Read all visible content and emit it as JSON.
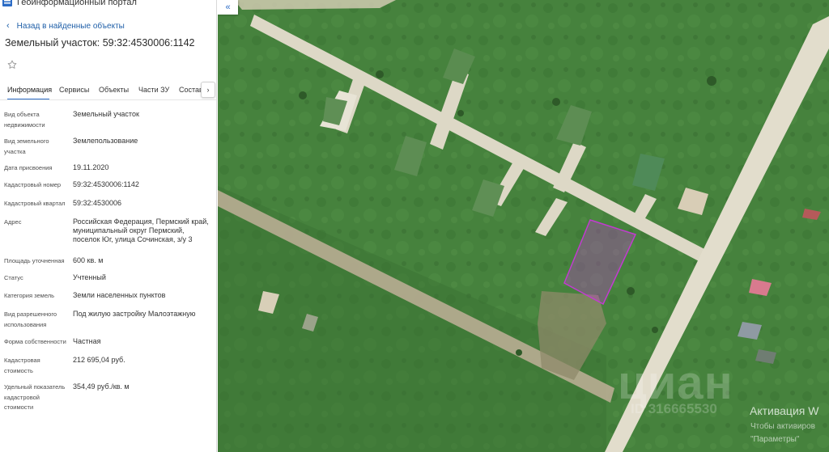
{
  "header": {
    "portal_name": "Геоинформационный портал"
  },
  "nav": {
    "back_label": "Назад в найденные объекты"
  },
  "object": {
    "title": "Земельный участок: 59:32:4530006:1142"
  },
  "tabs": [
    {
      "label": "Информация",
      "active": true
    },
    {
      "label": "Сервисы",
      "active": false
    },
    {
      "label": "Объекты",
      "active": false
    },
    {
      "label": "Части ЗУ",
      "active": false
    },
    {
      "label": "Состав",
      "active": false
    }
  ],
  "info": {
    "rows": [
      {
        "label": "Вид объекта недвижимости",
        "value": "Земельный участок"
      },
      {
        "label": "Вид земельного участка",
        "value": "Землепользование"
      },
      {
        "label": "Дата присвоения",
        "value": "19.11.2020"
      },
      {
        "label": "Кадастровый номер",
        "value": "59:32:4530006:1142"
      },
      {
        "label": "Кадастровый квартал",
        "value": "59:32:4530006"
      },
      {
        "label": "Адрес",
        "value": "Российская Федерация, Пермский край, муниципальный округ Пермский, поселок Юг, улица Сочинская, з/у 3"
      },
      {
        "label": "Площадь уточненная",
        "value": "600 кв. м"
      },
      {
        "label": "Статус",
        "value": "Учтенный"
      },
      {
        "label": "Категория земель",
        "value": "Земли населенных пунктов"
      },
      {
        "label": "Вид разрешенного использования",
        "value": "Под жилую застройку Малоэтажную"
      },
      {
        "label": "Форма собственности",
        "value": "Частная"
      },
      {
        "label": "Кадастровая стоимость",
        "value": "212 695,04 руб."
      },
      {
        "label": "Удельный показатель кадастровой стоимости",
        "value": "354,49 руб./кв. м"
      }
    ]
  },
  "map": {
    "watermark_brand": "циан",
    "watermark_phone": "ID 316665530",
    "activation_title": "Активация W",
    "activation_line2": "Чтобы активиров",
    "activation_line3": "\"Параметры\"",
    "parcel_color": "#c23bd0"
  },
  "icons": {
    "back": "chevron-left-icon",
    "favorite": "star-outline-icon",
    "tabs_next": "chevron-right-icon",
    "collapse": "double-chevron-left-icon"
  }
}
